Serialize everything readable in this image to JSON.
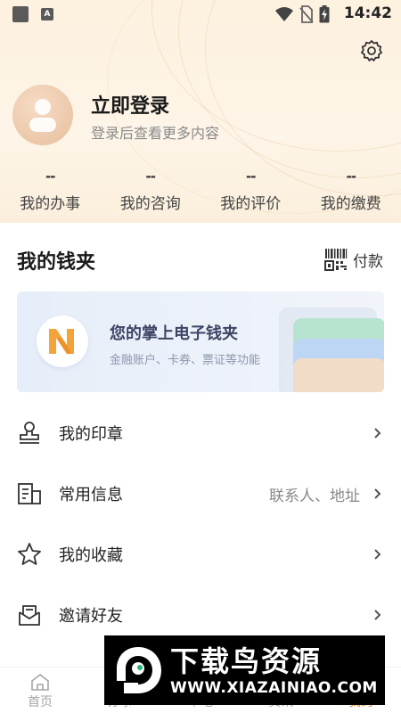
{
  "status_bar": {
    "time": "14:42",
    "a_badge": "A"
  },
  "profile": {
    "title": "立即登录",
    "subtitle": "登录后查看更多内容"
  },
  "stats": [
    {
      "value": "--",
      "label": "我的办事"
    },
    {
      "value": "--",
      "label": "我的咨询"
    },
    {
      "value": "--",
      "label": "我的评价"
    },
    {
      "value": "--",
      "label": "我的缴费"
    }
  ],
  "wallet": {
    "title": "我的钱夹",
    "pay_label": "付款",
    "card_title": "您的掌上电子钱夹",
    "card_subtitle": "金融账户、卡券、票证等功能"
  },
  "menu": [
    {
      "label": "我的印章",
      "hint": "",
      "icon": "stamp-icon"
    },
    {
      "label": "常用信息",
      "hint": "联系人、地址",
      "icon": "info-card-icon"
    },
    {
      "label": "我的收藏",
      "hint": "",
      "icon": "star-icon"
    },
    {
      "label": "邀请好友",
      "hint": "",
      "icon": "invite-mail-icon"
    }
  ],
  "bottom_nav": [
    {
      "label": "首页",
      "icon": "home-icon"
    },
    {
      "label": "办事",
      "icon": "service-icon"
    },
    {
      "label": "本地",
      "icon": "local-icon"
    },
    {
      "label": "资讯",
      "icon": "news-icon"
    },
    {
      "label": "我的",
      "icon": "mine-icon"
    }
  ],
  "watermark": {
    "title": "下载鸟资源",
    "url": "WWW.XIAZAINIAO.COM"
  },
  "colors": {
    "accent": "#d98a38",
    "header_bg": "#fdf1df",
    "card_bg": "#e6eef9"
  }
}
